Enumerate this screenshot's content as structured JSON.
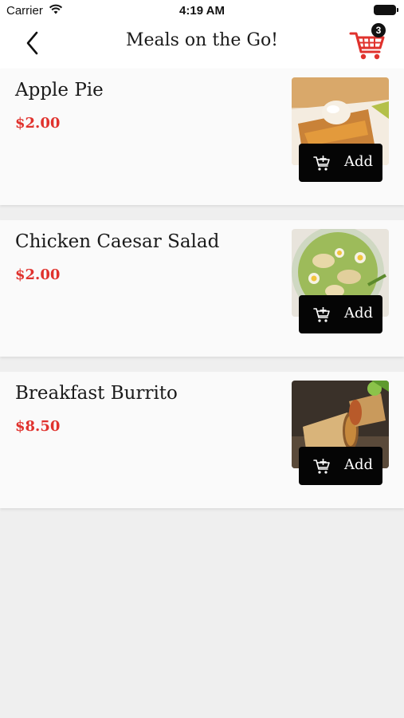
{
  "status_bar": {
    "carrier": "Carrier",
    "time": "4:19 AM"
  },
  "nav": {
    "title": "Meals on the Go!",
    "back_icon": "chevron-left-icon",
    "cart_icon": "shopping-cart-icon",
    "cart_count": "3",
    "accent_color": "#e0322d"
  },
  "menu": {
    "add_label": "Add",
    "items": [
      {
        "name": "Apple Pie",
        "price": "$2.00",
        "image": "apple-pie-photo"
      },
      {
        "name": "Chicken Caesar Salad",
        "price": "$2.00",
        "image": "chicken-caesar-salad-photo"
      },
      {
        "name": "Breakfast Burrito",
        "price": "$8.50",
        "image": "breakfast-burrito-photo"
      }
    ]
  }
}
